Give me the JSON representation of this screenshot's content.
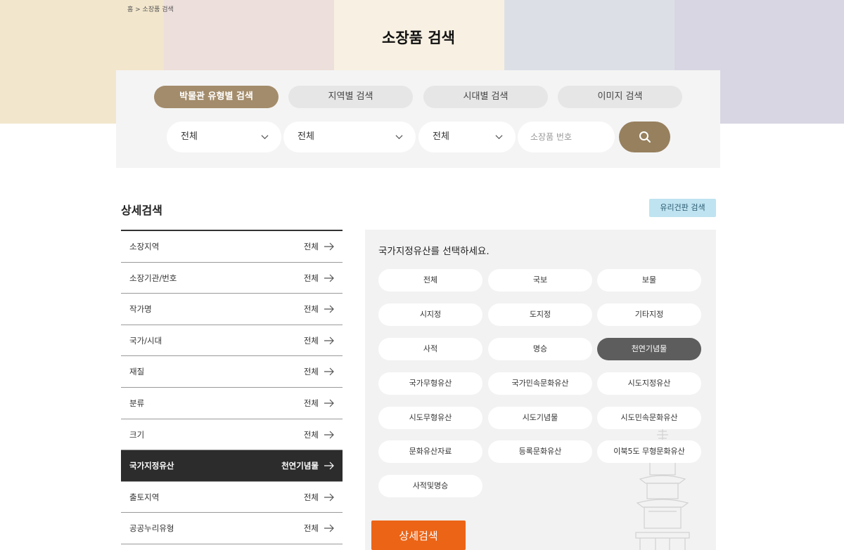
{
  "breadcrumb": "홈 > 소장품 검색",
  "page_title": "소장품 검색",
  "search": {
    "tabs": [
      {
        "label": "박물관 유형별 검색",
        "active": true
      },
      {
        "label": "지역별 검색",
        "active": false
      },
      {
        "label": "시대별 검색",
        "active": false
      },
      {
        "label": "이미지 검색",
        "active": false
      }
    ],
    "selects": [
      "전체",
      "전체",
      "전체"
    ],
    "input_placeholder": "소장품 번호",
    "button_icon": "search-icon"
  },
  "detail": {
    "title": "상세검색",
    "glass_button": "유리건판 검색",
    "filters": [
      {
        "label": "소장지역",
        "value": "전체"
      },
      {
        "label": "소장기관/번호",
        "value": "전체"
      },
      {
        "label": "작가명",
        "value": "전체"
      },
      {
        "label": "국가/시대",
        "value": "전체"
      },
      {
        "label": "재질",
        "value": "전체"
      },
      {
        "label": "분류",
        "value": "전체"
      },
      {
        "label": "크기",
        "value": "전체"
      },
      {
        "label": "국가지정유산",
        "value": "천연기념물",
        "active": true
      },
      {
        "label": "출토지역",
        "value": "전체"
      },
      {
        "label": "공공누리유형",
        "value": "전체"
      }
    ],
    "heritage_title": "국가지정유산를 선택하세요.",
    "heritage_options": [
      "전체",
      "국보",
      "보물",
      "시지정",
      "도지정",
      "기타지정",
      "사적",
      "명승",
      "천연기념물",
      "국가무형유산",
      "국가민속문화유산",
      "시도지정유산",
      "시도무형유산",
      "시도기념물",
      "시도민속문화유산",
      "문화유산자료",
      "등록문화유산",
      "이북5도 무형문화유산",
      "사적및명승"
    ],
    "selected_option": "천연기념물",
    "submit_label": "상세검색"
  },
  "colors": {
    "accent_brown": "#a38c6b",
    "submit_orange": "#ec6416",
    "active_row": "#2c2c2c",
    "glass_button": "#bfe3f0"
  }
}
